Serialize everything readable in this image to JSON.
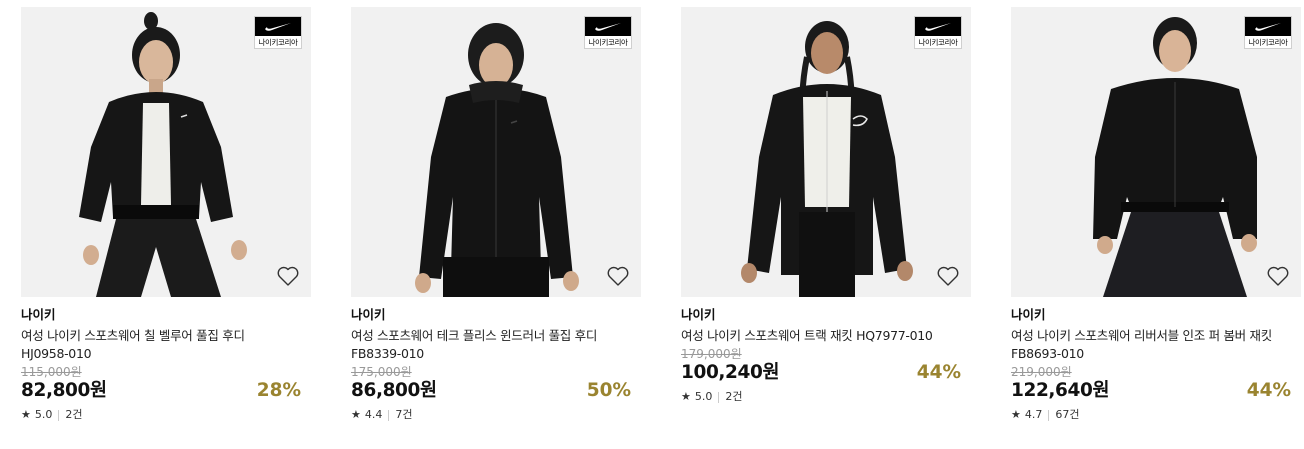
{
  "products": [
    {
      "brand": "나이키",
      "name": "여성 나이키 스포츠웨어 칠 벨루어 풀집 후디 HJ0958-010",
      "original_price": "115,000원",
      "price": "82,800원",
      "discount": "28%",
      "rating": "5.0",
      "reviews": "2건",
      "badge_text": "나이키코리아"
    },
    {
      "brand": "나이키",
      "name": "여성 스포츠웨어 테크 플리스 윈드러너 풀집 후디 FB8339-010",
      "original_price": "175,000원",
      "price": "86,800원",
      "discount": "50%",
      "rating": "4.4",
      "reviews": "7건",
      "badge_text": "나이키코리아"
    },
    {
      "brand": "나이키",
      "name": "여성 나이키 스포츠웨어 트랙 재킷 HQ7977-010",
      "original_price": "179,000원",
      "price": "100,240원",
      "discount": "44%",
      "rating": "5.0",
      "reviews": "2건",
      "badge_text": "나이키코리아"
    },
    {
      "brand": "나이키",
      "name": "여성 나이키 스포츠웨어 리버서블 인조 퍼 봄버 재킷 FB8693-010",
      "original_price": "219,000원",
      "price": "122,640원",
      "discount": "44%",
      "rating": "4.7",
      "reviews": "67건",
      "badge_text": "나이키코리아"
    }
  ],
  "colors": {
    "discount": "#9a8430",
    "image_bg": "#f1f1f1",
    "strike_price": "#999999"
  },
  "icons": {
    "wishlist": "heart-outline-icon",
    "rating": "star-icon",
    "brand_logo": "nike-swoosh-icon"
  }
}
